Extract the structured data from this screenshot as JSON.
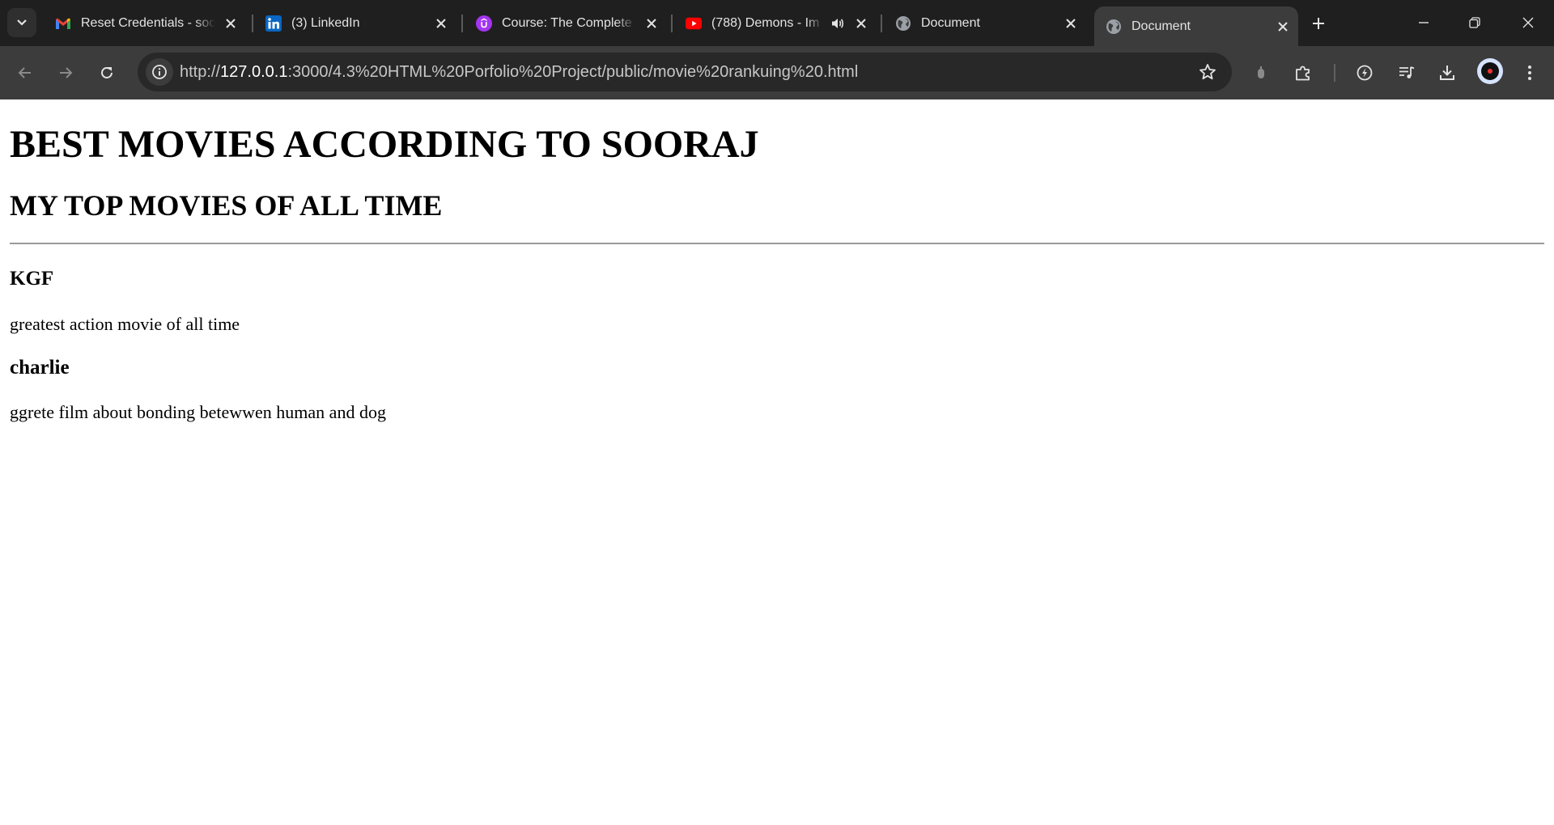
{
  "browser": {
    "tabs": [
      {
        "title": "Reset Credentials - soor",
        "favicon": "gmail-icon",
        "active": false
      },
      {
        "title": "(3) LinkedIn",
        "favicon": "linkedin-icon",
        "active": false
      },
      {
        "title": "Course: The Complete 2",
        "favicon": "udemy-icon",
        "active": false
      },
      {
        "title": "(788) Demons - Im",
        "favicon": "youtube-icon",
        "active": false,
        "audio": true
      },
      {
        "title": "Document",
        "favicon": "globe-icon",
        "active": false
      },
      {
        "title": "Document",
        "favicon": "globe-icon",
        "active": true
      }
    ],
    "address_bar": {
      "scheme": "http://",
      "host": "127.0.0.1",
      "rest": ":3000/4.3%20HTML%20Porfolio%20Project/public/movie%20rankuing%20.html"
    },
    "colors": {
      "tabstrip_bg": "#1f1f1f",
      "toolbar_bg": "#3c3c3c",
      "omnibox_bg": "#282828"
    }
  },
  "page": {
    "heading": "BEST MOVIES ACCORDING TO SOORAJ",
    "subheading": "MY TOP MOVIES OF ALL TIME",
    "movies": [
      {
        "title": "KGF",
        "description": "greatest action movie of all time"
      },
      {
        "title": "charlie",
        "description": "ggrete film about bonding betewwen human and dog"
      }
    ]
  }
}
